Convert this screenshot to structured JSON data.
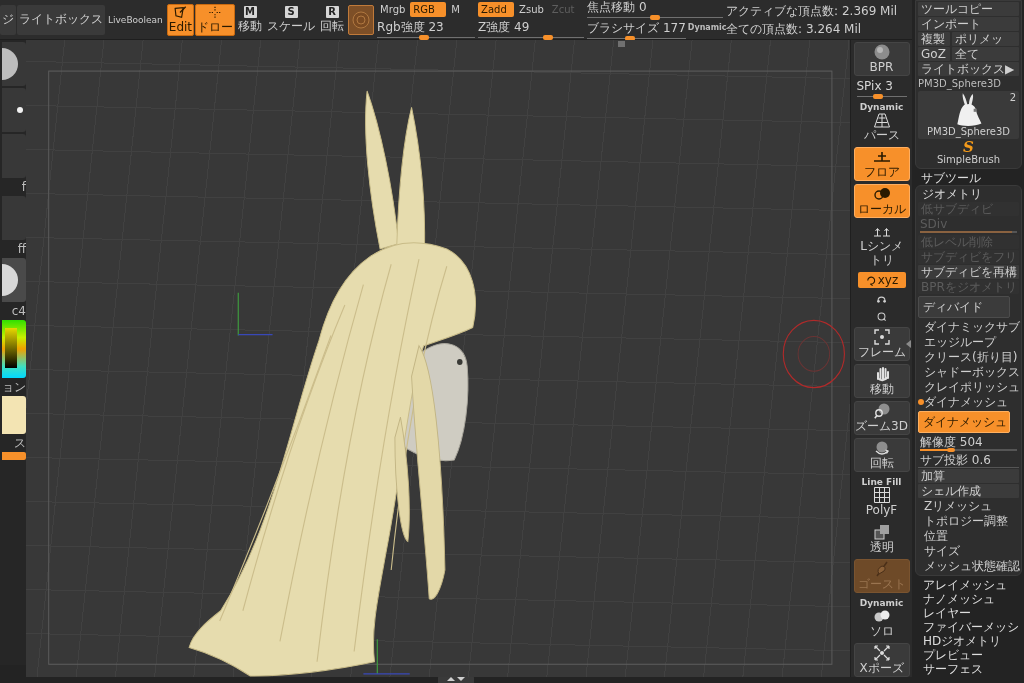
{
  "top_toolbar": {
    "buttons": [
      {
        "label": "ジ"
      },
      {
        "label": "ライトボックス"
      }
    ],
    "live_boolean": {
      "label": "LiveBoolean",
      "on": false
    },
    "modes": [
      {
        "kind": "edit",
        "label": "Edit",
        "on": true
      },
      {
        "kind": "draw",
        "label": "ドロー",
        "on": true
      },
      {
        "kind": "move",
        "badge": "M",
        "label": "移動",
        "on": false
      },
      {
        "kind": "scale",
        "badge": "S",
        "label": "スケール",
        "on": false
      },
      {
        "kind": "rotate",
        "badge": "R",
        "label": "回転",
        "on": false
      }
    ],
    "rgb": {
      "modes": [
        {
          "label": "Mrgb",
          "selected": false
        },
        {
          "label": "RGB",
          "selected": true
        },
        {
          "label": "M",
          "selected": false
        }
      ],
      "slider": {
        "label": "Rgb強度 23",
        "level": 0.48
      }
    },
    "z": {
      "modes": [
        {
          "label": "Zadd",
          "selected": true,
          "disabled": false
        },
        {
          "label": "Zsub",
          "selected": false,
          "disabled": false
        },
        {
          "label": "Zcut",
          "selected": false,
          "disabled": true
        }
      ],
      "slider": {
        "label": "Z強度 49",
        "level": 0.68
      }
    },
    "focal_shift": {
      "label": "焦点移動 0",
      "level": 0.5
    },
    "brush_size": {
      "label": "ブラシサイズ 177",
      "level": 0.43,
      "badge": "Dynamic"
    },
    "stats": [
      "アクティブな頂点数: 2.369 Mil",
      "全ての頂点数: 3.264 Mil"
    ]
  },
  "left_shelf": [
    {
      "kind": "brush"
    },
    {
      "kind": "stroke"
    },
    {
      "kind": "blank",
      "label": "f"
    },
    {
      "kind": "blank",
      "label": "ff"
    },
    {
      "kind": "material",
      "label": "c4"
    },
    {
      "kind": "picker",
      "label": "ョン"
    },
    {
      "kind": "swatch",
      "label": "ス"
    },
    {
      "kind": "bar"
    }
  ],
  "view_controls": [
    {
      "kind": "bpr",
      "label": "BPR",
      "on": false,
      "disabled": false
    },
    {
      "kind": "spix",
      "label": "SPix 3",
      "level": 0.4
    },
    {
      "kind": "perspective",
      "caption": "Dynamic",
      "label": "パース",
      "on": false,
      "disabled": false
    },
    {
      "kind": "floor",
      "label": "フロア",
      "on": true,
      "disabled": false
    },
    {
      "kind": "local",
      "label": "ローカル",
      "on": true,
      "disabled": false
    },
    {
      "kind": "lsym",
      "label": "Lシンメトリ",
      "on": false,
      "disabled": false
    },
    {
      "kind": "xyz",
      "label": "xyz",
      "on": true,
      "disabled": false
    },
    {
      "kind": "rot_y",
      "on": false,
      "disabled": false
    },
    {
      "kind": "rot_z",
      "on": false,
      "disabled": false
    },
    {
      "kind": "frame",
      "label": "フレーム",
      "on": false,
      "disabled": false
    },
    {
      "kind": "move",
      "label": "移動",
      "on": false,
      "disabled": false
    },
    {
      "kind": "zoom",
      "label": "ズーム3D",
      "on": false,
      "disabled": false
    },
    {
      "kind": "rotate",
      "label": "回転",
      "on": false,
      "disabled": false
    },
    {
      "kind": "polyf",
      "caption": "Line Fill",
      "label": "PolyF",
      "on": false,
      "disabled": false
    },
    {
      "kind": "transp",
      "label": "透明",
      "on": false,
      "disabled": false
    },
    {
      "kind": "ghost",
      "label": "ゴースト",
      "on": false,
      "disabled": true
    },
    {
      "kind": "solo",
      "caption": "Dynamic",
      "label": "ソロ",
      "on": false,
      "disabled": false
    },
    {
      "kind": "xpose",
      "label": "Xポーズ",
      "on": false,
      "disabled": false
    }
  ],
  "tool_palette": {
    "buttons": [
      {
        "label": "ツールコピー"
      },
      {
        "label": "インポート"
      }
    ],
    "pairs": [
      [
        {
          "label": "複製"
        },
        {
          "label": "ポリメッ"
        }
      ],
      [
        {
          "label": "GoZ"
        },
        {
          "label": "全て"
        }
      ]
    ],
    "lightbox": "ライトボックス▶",
    "tool_name": "PM3D_Sphere3D",
    "tools": [
      {
        "kind": "model",
        "label": "PM3D_Sphere3D",
        "count": "2"
      },
      {
        "kind": "brush",
        "label": "SimpleBrush",
        "glyph": "S"
      }
    ]
  },
  "subtool": {
    "title": "サブツール"
  },
  "geometry": {
    "title": "ジオメトリ",
    "items": [
      {
        "kind": "button",
        "label": "低サブディビ",
        "disabled": true
      },
      {
        "kind": "slider",
        "label": "SDiv",
        "disabled": true,
        "level": 0.95
      },
      {
        "kind": "button",
        "label": "低レベル削除",
        "disabled": true
      },
      {
        "kind": "button",
        "label": "サブディビをフリ",
        "disabled": true
      },
      {
        "kind": "button",
        "label": "サブディビを再構",
        "disabled": false
      },
      {
        "kind": "button",
        "label": "BPRをジオメトリ",
        "disabled": true
      },
      {
        "kind": "large",
        "label": "ディバイド",
        "on": false
      },
      {
        "kind": "section",
        "label": "ダイナミックサブ",
        "expanded": false
      },
      {
        "kind": "section",
        "label": "エッジループ",
        "expanded": false
      },
      {
        "kind": "section",
        "label": "クリース(折り目)",
        "expanded": false
      },
      {
        "kind": "section",
        "label": "シャドーボックス",
        "expanded": false
      },
      {
        "kind": "section",
        "label": "クレイポリッシュ",
        "expanded": false
      },
      {
        "kind": "section",
        "label": "ダイナメッシュ",
        "expanded": true
      },
      {
        "kind": "large",
        "label": "ダイナメッシュ",
        "on": true
      },
      {
        "kind": "slider",
        "label": "解像度 504",
        "disabled": false,
        "level": 0.3
      },
      {
        "kind": "value",
        "label": "サブ投影 0.6"
      },
      {
        "kind": "button",
        "label": "加算",
        "disabled": false
      },
      {
        "kind": "button",
        "label": "シェル作成",
        "disabled": false
      },
      {
        "kind": "section",
        "label": "Zリメッシュ",
        "expanded": false
      },
      {
        "kind": "section",
        "label": "トポロジー調整",
        "expanded": false
      },
      {
        "kind": "section",
        "label": "位置",
        "expanded": false
      },
      {
        "kind": "section",
        "label": "サイズ",
        "expanded": false
      },
      {
        "kind": "section",
        "label": "メッシュ状態確認",
        "expanded": false
      }
    ]
  },
  "palettes": [
    {
      "label": "アレイメッシュ"
    },
    {
      "label": "ナノメッシュ"
    },
    {
      "label": "レイヤー"
    },
    {
      "label": "ファイバーメッシ"
    },
    {
      "label": "HDジオメトリ"
    },
    {
      "label": "プレビュー"
    },
    {
      "label": "サーフェス"
    }
  ]
}
